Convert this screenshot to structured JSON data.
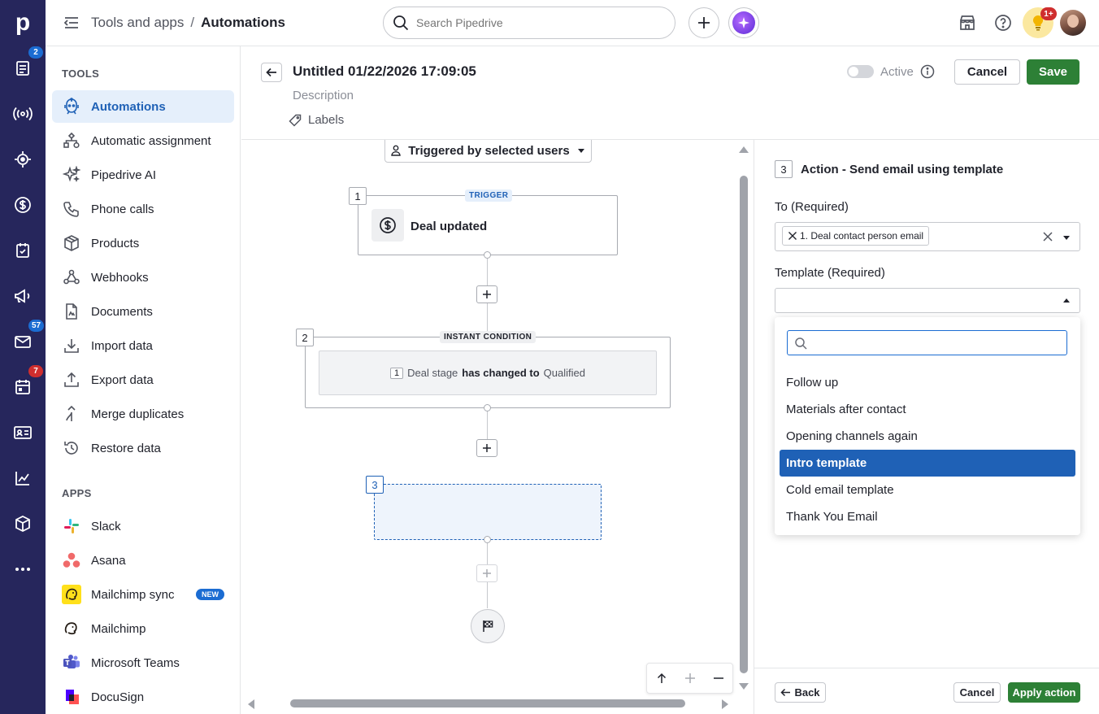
{
  "rail": {
    "logo": "p",
    "badges": {
      "deals": "2",
      "mail": "57",
      "calendar": "7"
    },
    "colors": {
      "bg": "#26265c",
      "badge_blue": "#1b6cd2",
      "badge_red": "#cf2e2e"
    }
  },
  "topbar": {
    "breadcrumb_parent": "Tools and apps",
    "breadcrumb_separator": "/",
    "breadcrumb_current": "Automations",
    "search_placeholder": "Search Pipedrive",
    "notification_badge": "1+"
  },
  "sidebar": {
    "tools_heading": "TOOLS",
    "tools": [
      {
        "label": "Automations",
        "icon": "automation-robot-icon",
        "active": true
      },
      {
        "label": "Automatic assignment",
        "icon": "assignment-icon"
      },
      {
        "label": "Pipedrive AI",
        "icon": "sparkles-icon"
      },
      {
        "label": "Phone calls",
        "icon": "phone-icon"
      },
      {
        "label": "Products",
        "icon": "box-icon"
      },
      {
        "label": "Webhooks",
        "icon": "webhook-icon"
      },
      {
        "label": "Documents",
        "icon": "document-icon"
      },
      {
        "label": "Import data",
        "icon": "download-icon"
      },
      {
        "label": "Export data",
        "icon": "upload-icon"
      },
      {
        "label": "Merge duplicates",
        "icon": "merge-icon"
      },
      {
        "label": "Restore data",
        "icon": "restore-icon"
      }
    ],
    "apps_heading": "APPS",
    "apps": [
      {
        "label": "Slack",
        "icon": "slack-icon"
      },
      {
        "label": "Asana",
        "icon": "asana-icon"
      },
      {
        "label": "Mailchimp sync",
        "icon": "mailchimp-icon",
        "badge": "NEW"
      },
      {
        "label": "Mailchimp",
        "icon": "mailchimp-icon"
      },
      {
        "label": "Microsoft Teams",
        "icon": "teams-icon"
      },
      {
        "label": "DocuSign",
        "icon": "docusign-icon"
      }
    ]
  },
  "editor": {
    "title": "Untitled 01/22/2026 17:09:05",
    "description_placeholder": "Description",
    "labels_text": "Labels",
    "active_label": "Active",
    "active_on": false,
    "cancel_label": "Cancel",
    "save_label": "Save"
  },
  "canvas": {
    "trigger_mode": "Triggered by selected users",
    "nodes": [
      {
        "number": "1",
        "tag": "TRIGGER",
        "title": "Deal updated"
      },
      {
        "number": "2",
        "tag": "INSTANT CONDITION",
        "cond_num": "1",
        "cond_field": "Deal stage",
        "cond_op": "has changed to",
        "cond_value": "Qualified"
      },
      {
        "number": "3"
      }
    ]
  },
  "panel": {
    "step_number": "3",
    "title": "Action - Send email using template",
    "to_label": "To (Required)",
    "to_chip": "1. Deal contact person email",
    "template_label": "Template (Required)",
    "template_value": "",
    "search_value": "",
    "options": [
      "Follow up",
      "Materials after contact",
      "Opening channels again",
      "Intro template",
      "Cold email template",
      "Thank You Email"
    ],
    "selected_option": "Intro template",
    "back_label": "Back",
    "cancel_label": "Cancel",
    "apply_label": "Apply action"
  },
  "colors": {
    "accent_blue": "#1f61b6",
    "save_green": "#2d8036",
    "active_bg": "#e5effb",
    "trigger_tag_bg": "#e5effb",
    "condition_tag_bg": "#eeeff1"
  }
}
